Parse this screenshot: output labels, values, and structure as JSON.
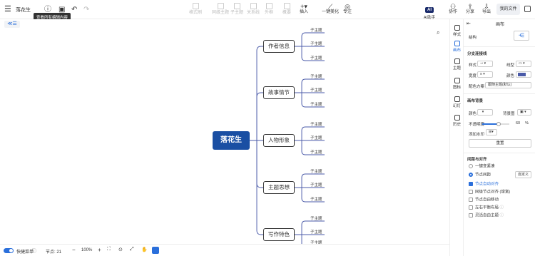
{
  "app": {
    "title": "落花生",
    "file_button": "我的文件"
  },
  "tooltip": "查看所有编辑内容",
  "toolbar": {
    "items": [
      "格式刷",
      "同级主题",
      "子主题",
      "关系线",
      "外框",
      "概要",
      "插入",
      "一键美化",
      "专注"
    ]
  },
  "header_right": {
    "ai_label": "AI助手",
    "collab": "协作",
    "share": "分享",
    "export": "导出"
  },
  "mindmap": {
    "root": "落花生",
    "branches": [
      {
        "label": "作者信息",
        "children": [
          "子主题",
          "子主题",
          "子主题"
        ]
      },
      {
        "label": "故事情节",
        "children": [
          "子主题",
          "子主题",
          "子主题"
        ]
      },
      {
        "label": "人物形象",
        "children": [
          "子主题",
          "子主题",
          "子主题"
        ]
      },
      {
        "label": "主题思想",
        "children": [
          "子主题",
          "子主题",
          "子主题"
        ]
      },
      {
        "label": "写作特色",
        "children": [
          "子主题",
          "子主题",
          "子主题"
        ]
      }
    ]
  },
  "statusbar": {
    "toggle_label": "快捷菜单",
    "node_count": "节点: 21",
    "zoom": "100%"
  },
  "rightbar": {
    "items": [
      "样式",
      "画布",
      "主题",
      "图标",
      "幻灯",
      "历史"
    ],
    "active": "画布"
  },
  "panel": {
    "title": "画布",
    "structure_label": "结构",
    "branch_section": "分支连接线",
    "style_label": "样式",
    "line_label": "线型",
    "width_label": "宽度",
    "color_label": "颜色",
    "scheme_label": "配色方案",
    "scheme_value": "跟随主题(默认)",
    "bg_section": "画布背景",
    "bg_color_label": "颜色",
    "bg_image_label": "背景图",
    "opacity_label": "不透明度",
    "opacity_value": "60",
    "opacity_unit": "%",
    "watermark_label": "添加水印",
    "reset_button": "重置",
    "layout_section": "间距与对齐",
    "radio_auto": "一键变紧凑",
    "radio_node": "节点间距",
    "custom_button": "自定义",
    "chk_auto_layout": "节点自动对齐",
    "chk_same_width": "同级节点对齐 (增宽)",
    "chk_auto_spacing": "节点自由移动",
    "chk_balance": "左右平衡布局",
    "chk_free_topic": "灵活自由主题",
    "colors": {
      "accent": "#2a6fdb",
      "root": "#1a4fa3",
      "line": "#4a5aa8"
    }
  }
}
